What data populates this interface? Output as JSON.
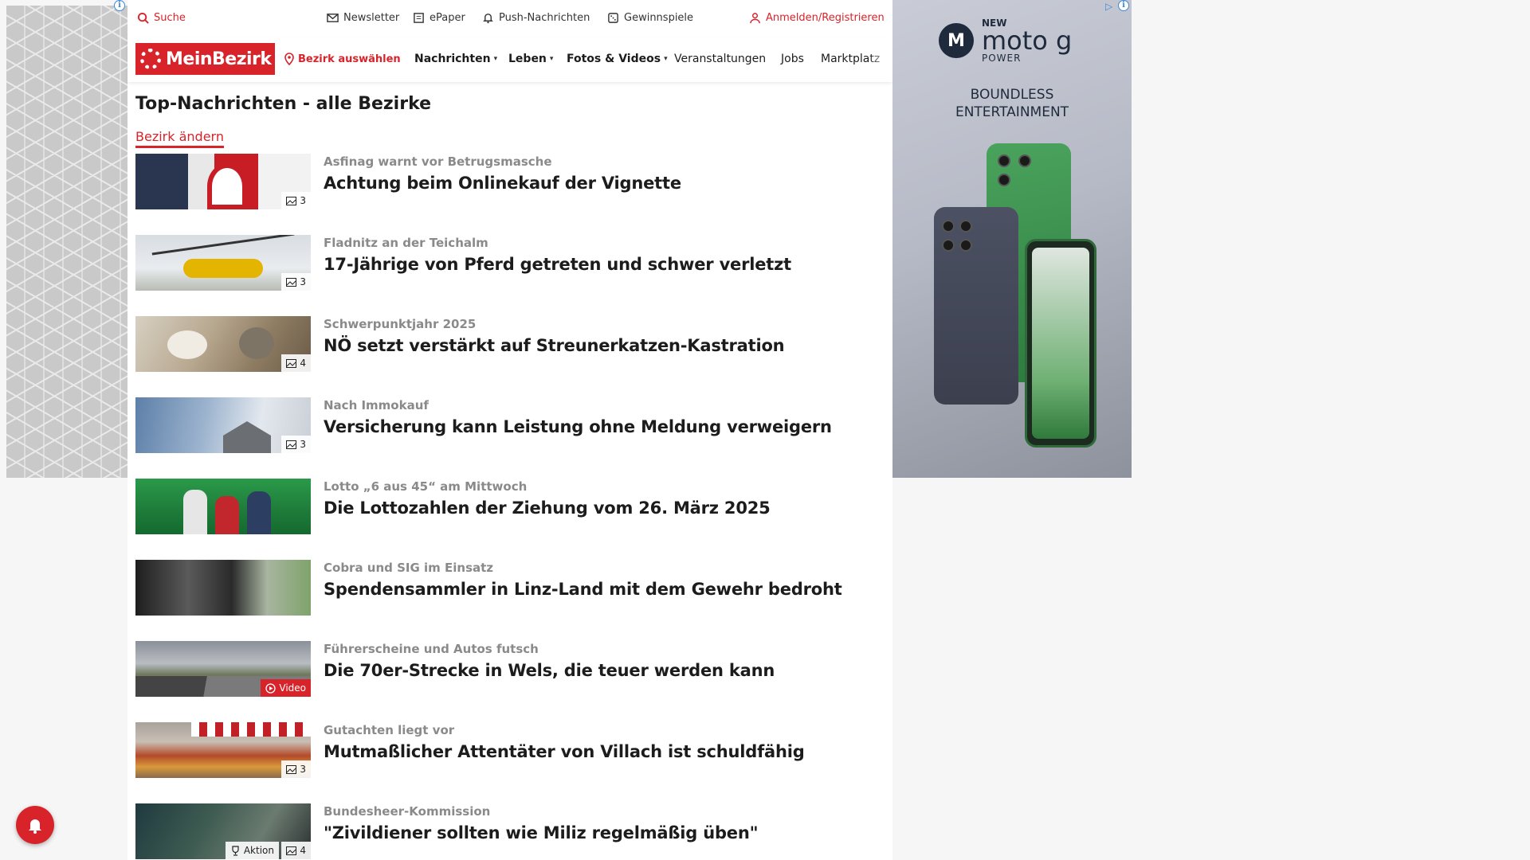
{
  "utility": {
    "search": "Suche",
    "newsletter": "Newsletter",
    "epaper": "ePaper",
    "push": "Push-Nachrichten",
    "gewinnspiele": "Gewinnspiele",
    "login": "Anmelden/Registrieren"
  },
  "nav": {
    "logo": "MeinBezirk",
    "bezirk": "Bezirk auswählen",
    "items": [
      "Nachrichten",
      "Leben",
      "Fotos & Videos",
      "Veranstaltungen",
      "Jobs",
      "Marktplatz"
    ]
  },
  "page": {
    "title": "Top-Nachrichten - alle Bezirke",
    "change_link": "Bezirk ändern"
  },
  "articles": [
    {
      "kicker": "Asfinag warnt vor Betrugsmasche",
      "headline": "Achtung beim Onlinekauf der Vignette",
      "badge": "3"
    },
    {
      "kicker": "Fladnitz an der Teichalm",
      "headline": "17-Jährige von Pferd getreten und schwer verletzt",
      "badge": "3"
    },
    {
      "kicker": "Schwerpunktjahr 2025",
      "headline": "NÖ setzt verstärkt auf Streunerkatzen-Kastration",
      "badge": "4"
    },
    {
      "kicker": "Nach Immokauf",
      "headline": "Versicherung kann Leistung ohne Meldung verweigern",
      "badge": "3"
    },
    {
      "kicker": "Lotto „6 aus 45“ am Mittwoch",
      "headline": "Die Lottozahlen der Ziehung vom 26. März 2025",
      "badge": ""
    },
    {
      "kicker": "Cobra und SIG im Einsatz",
      "headline": "Spendensammler in Linz-Land mit dem Gewehr bedroht",
      "badge": ""
    },
    {
      "kicker": "Führerscheine und Autos futsch",
      "headline": "Die 70er-Strecke in Wels, die teuer werden kann",
      "badge": "Video"
    },
    {
      "kicker": "Gutachten liegt vor",
      "headline": "Mutmaßlicher Attentäter von Villach ist schuldfähig",
      "badge": "3"
    },
    {
      "kicker": "Bundesheer-Kommission",
      "headline": "\"Zivildiener sollten wie Miliz regelmäßig üben\"",
      "badge": "4",
      "aktion": "Aktion"
    }
  ],
  "ad": {
    "new": "NEW",
    "brand": "moto g",
    "power": "POWER",
    "tagline_1": "BOUNDLESS",
    "tagline_2": "ENTERTAINMENT"
  },
  "colors": {
    "accent": "#d8232a"
  }
}
